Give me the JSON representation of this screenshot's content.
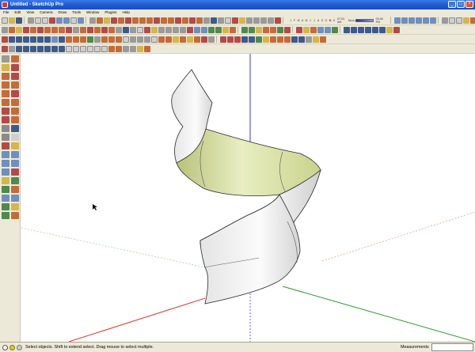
{
  "window": {
    "title": "Untitled - SketchUp Pro",
    "buttons": {
      "minimize": "_",
      "maximize": "□",
      "close": "×"
    }
  },
  "menu": {
    "items": [
      "File",
      "Edit",
      "View",
      "Camera",
      "Draw",
      "Tools",
      "Window",
      "Plugins",
      "Help"
    ]
  },
  "shadows": {
    "months": [
      "J",
      "F",
      "M",
      "A",
      "M",
      "J",
      "J",
      "A",
      "S",
      "O",
      "N",
      "D"
    ],
    "active_month_index": 10,
    "time_start": "07:03 AM",
    "noon": "Noon",
    "time_end": "04:46 PM"
  },
  "status": {
    "message": "Select objects. Shift to extend select. Drag mouse to select multiple.",
    "measurements_label": "Measurements",
    "measurements_value": ""
  },
  "colors": {
    "titlebar": "#1f5bd0",
    "chrome": "#ece9d8",
    "axis_blue": "#3a3ad8",
    "axis_red": "#e03030",
    "axis_green": "#2a9a2a",
    "surface_inner": "#d9e2a6",
    "surface_outer": "#f2f2f2"
  }
}
